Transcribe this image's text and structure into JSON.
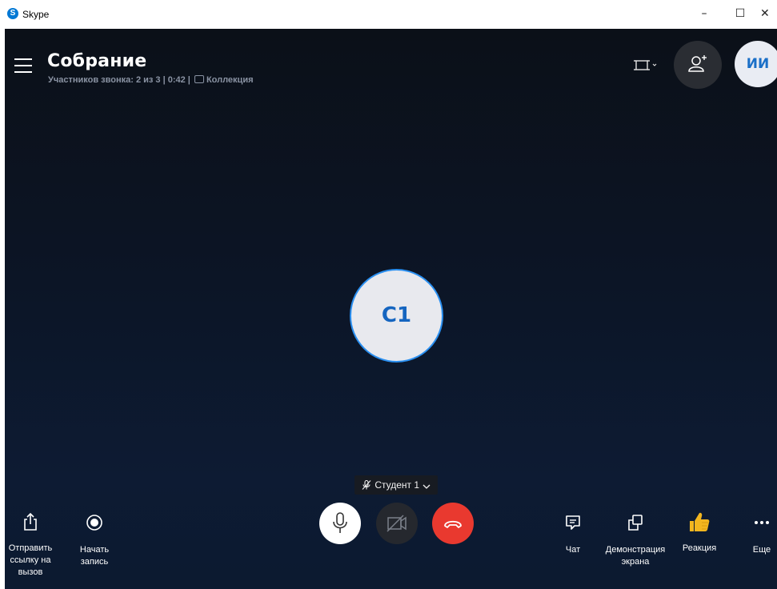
{
  "window": {
    "app_title": "Skype",
    "logo_letter": "S",
    "minimize_glyph": "–",
    "maximize_glyph": "☐",
    "close_glyph": "✕"
  },
  "call": {
    "title": "Собрание",
    "participants_text": "Участников звонка: 2 из 3 | 0:42 |",
    "collection_label": "Коллекция"
  },
  "header": {
    "self_initials": "ИИ"
  },
  "participant": {
    "initials": "С1",
    "name_tag": "Студент 1"
  },
  "controls": {
    "share_link_line1": "Отправить",
    "share_link_line2": "ссылку на",
    "share_link_line3": "вызов",
    "record_line1": "Начать",
    "record_line2": "запись",
    "chat_label": "Чат",
    "screen_share_line1": "Демонстрация",
    "screen_share_line2": "экрана",
    "reaction_label": "Реакция",
    "more_label": "Еще"
  },
  "colors": {
    "hangup": "#e9392f",
    "accent": "#1a6fc7",
    "reaction": "#f3b61f"
  },
  "icons": [
    "skype-logo-icon",
    "minimize-icon",
    "maximize-icon",
    "close-icon",
    "hamburger-menu-icon",
    "collection-icon",
    "layout-icon",
    "chevron-down-icon",
    "add-person-icon",
    "microphone-muted-icon",
    "share-icon",
    "record-icon",
    "microphone-icon",
    "camera-off-icon",
    "hangup-icon",
    "chat-icon",
    "screen-share-icon",
    "thumbs-up-icon",
    "more-icon"
  ]
}
